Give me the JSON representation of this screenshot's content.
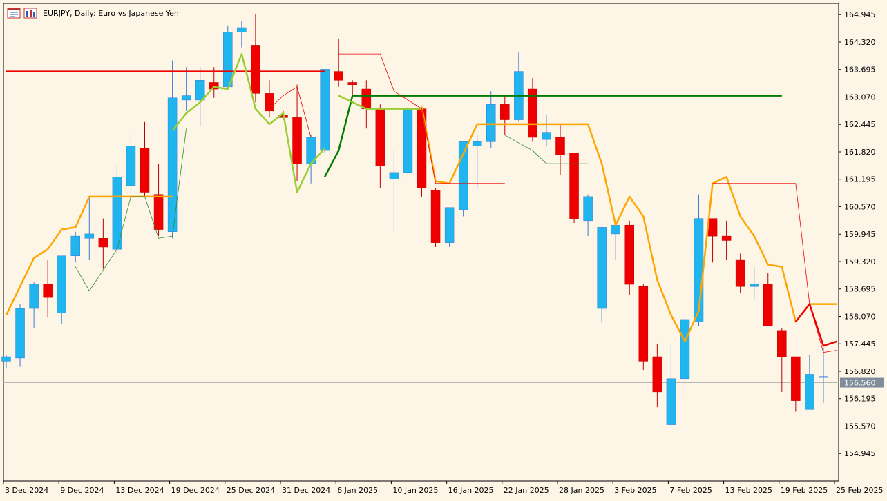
{
  "window": {
    "title": "EURJPY, Daily:  Euro vs Japanese Yen",
    "icons": [
      "chart-window-icon",
      "chart-properties-icon"
    ]
  },
  "colors": {
    "background": "#fdf5e6",
    "bull": "#1fb5ee",
    "bear": "#ee0000",
    "orange": "#ffa500",
    "lightgreen": "#9acd32",
    "darkgreen": "#007a00",
    "red": "#ee0000",
    "price_label_bg": "#7e8c9c"
  },
  "chart_data": {
    "type": "candlestick",
    "symbol": "EURJPY",
    "timeframe": "Daily",
    "description": "Euro vs Japanese Yen",
    "ylim": [
      154.32,
      165.2
    ],
    "price_ticks": [
      "164.945",
      "164.320",
      "163.695",
      "163.070",
      "162.445",
      "161.820",
      "161.195",
      "160.570",
      "159.945",
      "159.320",
      "158.695",
      "158.070",
      "157.445",
      "156.820",
      "156.195",
      "155.570",
      "154.945"
    ],
    "date_ticks": [
      {
        "label": "3 Dec 2024",
        "index": 0
      },
      {
        "label": "9 Dec 2024",
        "index": 4
      },
      {
        "label": "13 Dec 2024",
        "index": 8
      },
      {
        "label": "19 Dec 2024",
        "index": 12
      },
      {
        "label": "25 Dec 2024",
        "index": 16
      },
      {
        "label": "31 Dec 2024",
        "index": 20
      },
      {
        "label": "6 Jan 2025",
        "index": 24
      },
      {
        "label": "10 Jan 2025",
        "index": 28
      },
      {
        "label": "16 Jan 2025",
        "index": 32
      },
      {
        "label": "22 Jan 2025",
        "index": 36
      },
      {
        "label": "28 Jan 2025",
        "index": 40
      },
      {
        "label": "3 Feb 2025",
        "index": 44
      },
      {
        "label": "7 Feb 2025",
        "index": 48
      },
      {
        "label": "13 Feb 2025",
        "index": 52
      },
      {
        "label": "19 Feb 2025",
        "index": 56
      },
      {
        "label": "25 Feb 2025",
        "index": 60
      }
    ],
    "current_price": "156.560",
    "candles": [
      {
        "o": 157.05,
        "h": 157.2,
        "l": 156.9,
        "c": 157.15
      },
      {
        "o": 157.12,
        "h": 158.35,
        "l": 156.92,
        "c": 158.25
      },
      {
        "o": 158.25,
        "h": 158.85,
        "l": 157.8,
        "c": 158.8
      },
      {
        "o": 158.8,
        "h": 159.35,
        "l": 158.05,
        "c": 158.5
      },
      {
        "o": 158.15,
        "h": 159.4,
        "l": 157.9,
        "c": 159.45
      },
      {
        "o": 159.45,
        "h": 160.0,
        "l": 159.3,
        "c": 159.9
      },
      {
        "o": 159.85,
        "h": 160.8,
        "l": 159.35,
        "c": 159.95
      },
      {
        "o": 159.85,
        "h": 160.3,
        "l": 159.15,
        "c": 159.65
      },
      {
        "o": 159.6,
        "h": 161.5,
        "l": 159.5,
        "c": 161.25
      },
      {
        "o": 161.05,
        "h": 162.25,
        "l": 160.85,
        "c": 161.95
      },
      {
        "o": 161.9,
        "h": 162.5,
        "l": 160.8,
        "c": 160.9
      },
      {
        "o": 160.85,
        "h": 161.55,
        "l": 159.9,
        "c": 160.05
      },
      {
        "o": 160.0,
        "h": 163.9,
        "l": 159.85,
        "c": 163.05
      },
      {
        "o": 163.0,
        "h": 163.75,
        "l": 162.75,
        "c": 163.1
      },
      {
        "o": 163.0,
        "h": 163.75,
        "l": 162.4,
        "c": 163.45
      },
      {
        "o": 163.4,
        "h": 163.75,
        "l": 163.05,
        "c": 163.25
      },
      {
        "o": 163.3,
        "h": 164.7,
        "l": 163.25,
        "c": 164.55
      },
      {
        "o": 164.55,
        "h": 164.8,
        "l": 164.2,
        "c": 164.65
      },
      {
        "o": 164.25,
        "h": 164.95,
        "l": 162.95,
        "c": 163.15
      },
      {
        "o": 163.15,
        "h": 163.45,
        "l": 162.6,
        "c": 162.75
      },
      {
        "o": 162.65,
        "h": 162.75,
        "l": 162.55,
        "c": 162.6
      },
      {
        "o": 162.6,
        "h": 163.35,
        "l": 161.15,
        "c": 161.55
      },
      {
        "o": 161.55,
        "h": 162.2,
        "l": 161.1,
        "c": 162.15
      },
      {
        "o": 161.85,
        "h": 163.7,
        "l": 161.8,
        "c": 163.7
      },
      {
        "o": 163.65,
        "h": 164.4,
        "l": 163.3,
        "c": 163.45
      },
      {
        "o": 163.4,
        "h": 163.45,
        "l": 163.05,
        "c": 163.35
      },
      {
        "o": 163.25,
        "h": 163.45,
        "l": 162.35,
        "c": 162.8
      },
      {
        "o": 162.8,
        "h": 162.9,
        "l": 161.0,
        "c": 161.5
      },
      {
        "o": 161.2,
        "h": 161.85,
        "l": 160.0,
        "c": 161.35
      },
      {
        "o": 161.35,
        "h": 162.85,
        "l": 161.2,
        "c": 162.8
      },
      {
        "o": 162.8,
        "h": 162.85,
        "l": 160.8,
        "c": 161.0
      },
      {
        "o": 160.95,
        "h": 161.0,
        "l": 159.65,
        "c": 159.75
      },
      {
        "o": 159.75,
        "h": 160.55,
        "l": 159.65,
        "c": 160.55
      },
      {
        "o": 160.5,
        "h": 162.05,
        "l": 160.35,
        "c": 162.05
      },
      {
        "o": 161.95,
        "h": 162.2,
        "l": 161.0,
        "c": 162.05
      },
      {
        "o": 162.05,
        "h": 163.2,
        "l": 161.9,
        "c": 162.9
      },
      {
        "o": 162.9,
        "h": 163.1,
        "l": 162.2,
        "c": 162.55
      },
      {
        "o": 162.55,
        "h": 164.1,
        "l": 162.5,
        "c": 163.65
      },
      {
        "o": 163.25,
        "h": 163.5,
        "l": 162.05,
        "c": 162.15
      },
      {
        "o": 162.1,
        "h": 162.65,
        "l": 161.95,
        "c": 162.25
      },
      {
        "o": 162.15,
        "h": 162.45,
        "l": 161.3,
        "c": 161.75
      },
      {
        "o": 161.8,
        "h": 161.8,
        "l": 160.2,
        "c": 160.3
      },
      {
        "o": 160.25,
        "h": 160.85,
        "l": 159.9,
        "c": 160.8
      },
      {
        "o": 158.25,
        "h": 160.1,
        "l": 157.95,
        "c": 160.1
      },
      {
        "o": 159.95,
        "h": 160.25,
        "l": 159.35,
        "c": 160.15
      },
      {
        "o": 160.15,
        "h": 160.25,
        "l": 158.55,
        "c": 158.8
      },
      {
        "o": 158.75,
        "h": 158.8,
        "l": 156.85,
        "c": 157.05
      },
      {
        "o": 157.15,
        "h": 157.45,
        "l": 156.0,
        "c": 156.35
      },
      {
        "o": 155.6,
        "h": 157.45,
        "l": 155.55,
        "c": 156.65
      },
      {
        "o": 156.65,
        "h": 158.1,
        "l": 156.3,
        "c": 158.0
      },
      {
        "o": 157.95,
        "h": 160.85,
        "l": 157.85,
        "c": 160.3
      },
      {
        "o": 160.3,
        "h": 160.3,
        "l": 159.3,
        "c": 159.9
      },
      {
        "o": 159.9,
        "h": 160.25,
        "l": 159.35,
        "c": 159.8
      },
      {
        "o": 159.35,
        "h": 159.5,
        "l": 158.6,
        "c": 158.75
      },
      {
        "o": 158.75,
        "h": 159.2,
        "l": 158.45,
        "c": 158.8
      },
      {
        "o": 158.8,
        "h": 159.05,
        "l": 157.85,
        "c": 157.85
      },
      {
        "o": 157.75,
        "h": 157.8,
        "l": 156.35,
        "c": 157.15
      },
      {
        "o": 157.15,
        "h": 157.15,
        "l": 155.9,
        "c": 156.15
      },
      {
        "o": 155.95,
        "h": 157.2,
        "l": 155.95,
        "c": 156.75
      },
      {
        "o": 156.7,
        "h": 157.35,
        "l": 156.1,
        "c": 156.7
      }
    ],
    "lines": [
      {
        "name": "orange-line",
        "color": "#ffa500",
        "width": 2.5,
        "points": [
          [
            0,
            158.1
          ],
          [
            2,
            159.4
          ],
          [
            3,
            159.6
          ],
          [
            4,
            160.05
          ],
          [
            5,
            160.1
          ],
          [
            6,
            160.8
          ],
          [
            12,
            160.8
          ]
        ]
      },
      {
        "name": "orange-line-2",
        "color": "#ffa500",
        "width": 2.5,
        "points": [
          [
            30,
            162.85
          ],
          [
            31,
            161.15
          ],
          [
            32,
            161.1
          ],
          [
            34,
            162.45
          ],
          [
            42,
            162.45
          ],
          [
            43,
            161.55
          ],
          [
            44,
            160.15
          ],
          [
            45,
            160.8
          ],
          [
            46,
            160.35
          ],
          [
            47,
            158.9
          ],
          [
            48,
            158.1
          ],
          [
            49,
            157.5
          ],
          [
            50,
            158.2
          ],
          [
            51,
            161.1
          ],
          [
            52,
            161.25
          ],
          [
            53,
            160.35
          ],
          [
            54,
            159.9
          ],
          [
            55,
            159.25
          ],
          [
            56,
            159.2
          ],
          [
            57,
            157.95
          ],
          [
            58,
            158.35
          ],
          [
            59,
            158.35
          ],
          [
            60,
            158.35
          ]
        ]
      },
      {
        "name": "red-thick-line",
        "color": "#ee0000",
        "width": 2.5,
        "points": [
          [
            0,
            163.65
          ],
          [
            23,
            163.65
          ]
        ]
      },
      {
        "name": "red-thick-line-2",
        "color": "#ee0000",
        "width": 2.5,
        "points": [
          [
            57,
            157.95
          ],
          [
            58,
            158.35
          ],
          [
            59,
            157.4
          ],
          [
            60,
            157.5
          ]
        ]
      },
      {
        "name": "darkgreen-line",
        "color": "#007a00",
        "width": 2.5,
        "points": [
          [
            23,
            161.25
          ],
          [
            24,
            161.85
          ],
          [
            25,
            163.1
          ],
          [
            56,
            163.1
          ]
        ]
      },
      {
        "name": "lightgreen-line",
        "color": "#9acd32",
        "width": 2.5,
        "points": [
          [
            12,
            162.3
          ],
          [
            13,
            162.7
          ],
          [
            14,
            162.95
          ],
          [
            15,
            163.3
          ],
          [
            16,
            163.25
          ],
          [
            17,
            164.05
          ],
          [
            18,
            162.8
          ],
          [
            19,
            162.45
          ],
          [
            20,
            162.7
          ],
          [
            21,
            160.9
          ],
          [
            22,
            161.55
          ],
          [
            23,
            161.9
          ]
        ]
      },
      {
        "name": "lightgreen-line-2",
        "color": "#9acd32",
        "width": 2.5,
        "points": [
          [
            24,
            163.1
          ],
          [
            26,
            162.8
          ],
          [
            30,
            162.8
          ]
        ]
      },
      {
        "name": "red-thin-line",
        "color": "#ee0000",
        "width": 0.8,
        "points": [
          [
            24,
            164.05
          ],
          [
            27,
            164.05
          ],
          [
            28,
            163.2
          ],
          [
            30,
            162.8
          ],
          [
            31,
            161.1
          ],
          [
            36,
            161.1
          ]
        ]
      },
      {
        "name": "red-thin-line-2",
        "color": "#ee0000",
        "width": 0.8,
        "points": [
          [
            51,
            161.1
          ],
          [
            57,
            161.1
          ],
          [
            58,
            158.35
          ],
          [
            59,
            157.25
          ],
          [
            60,
            157.3
          ]
        ]
      },
      {
        "name": "red-thin-line-3",
        "color": "#ee0000",
        "width": 0.8,
        "points": [
          [
            19,
            162.8
          ],
          [
            20,
            163.1
          ],
          [
            21,
            163.3
          ],
          [
            22,
            162.15
          ]
        ]
      },
      {
        "name": "green-thin-line",
        "color": "#2e8b2e",
        "width": 0.8,
        "points": [
          [
            5,
            159.2
          ],
          [
            6,
            158.65
          ],
          [
            8,
            159.6
          ],
          [
            9,
            160.8
          ],
          [
            10,
            160.8
          ],
          [
            11,
            159.85
          ],
          [
            12,
            159.9
          ],
          [
            13,
            162.35
          ]
        ]
      },
      {
        "name": "green-thin-line-2",
        "color": "#2e8b2e",
        "width": 0.8,
        "points": [
          [
            36,
            162.2
          ],
          [
            38,
            161.85
          ],
          [
            39,
            161.55
          ],
          [
            42,
            161.55
          ]
        ]
      }
    ]
  }
}
